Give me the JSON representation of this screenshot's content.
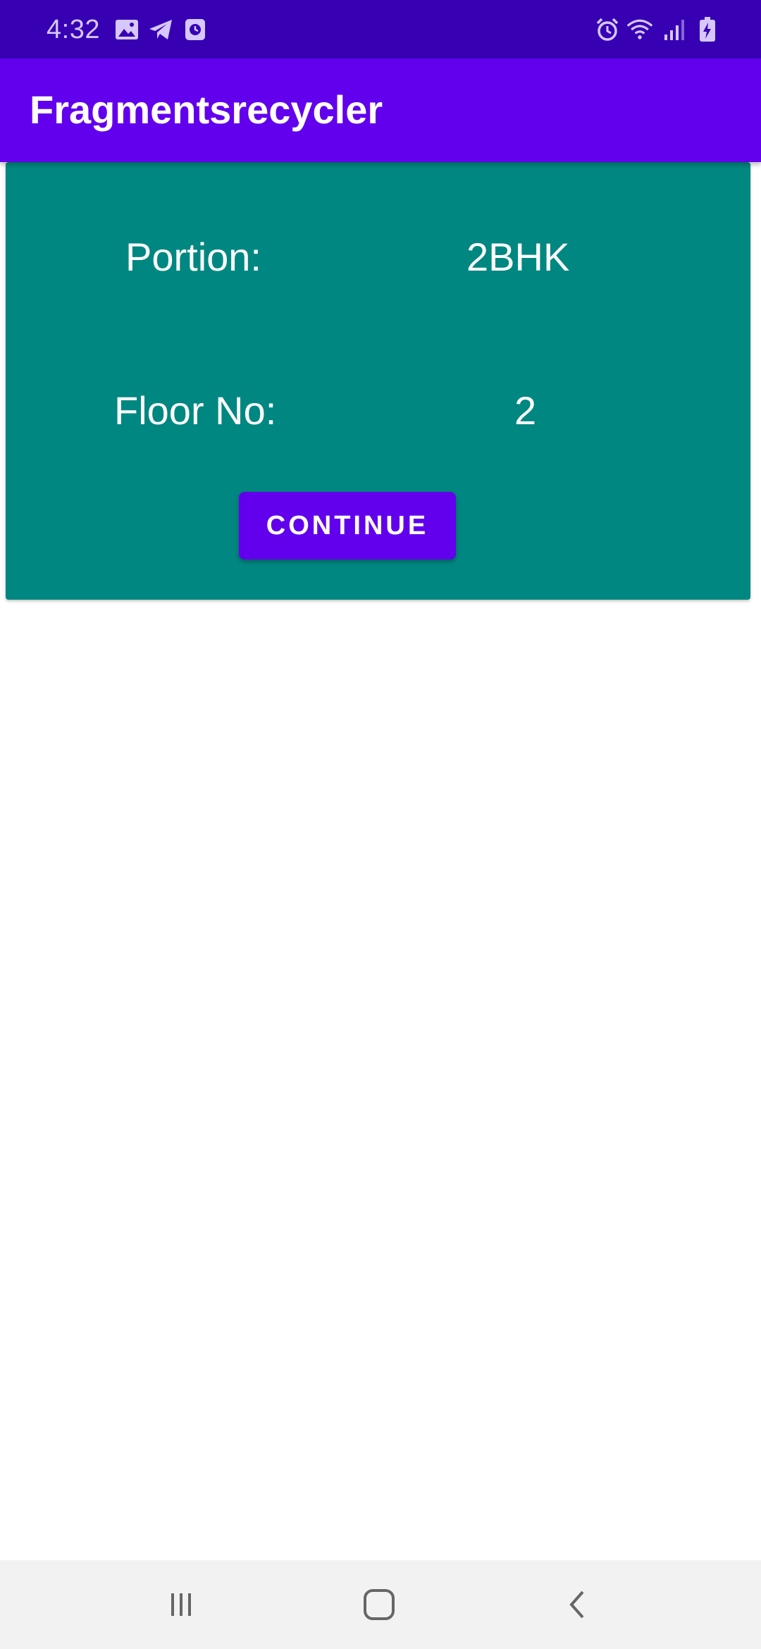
{
  "status_bar": {
    "time": "4:32",
    "icons_left": [
      "gallery-icon",
      "telegram-icon",
      "clock-app-icon"
    ],
    "icons_right": [
      "alarm-icon",
      "wifi-icon",
      "signal-icon",
      "battery-charging-icon"
    ]
  },
  "app_bar": {
    "title": "Fragmentsrecycler"
  },
  "card": {
    "background_color": "#008781",
    "rows": [
      {
        "label": "Portion:",
        "value": "2BHK"
      },
      {
        "label": "Floor No:",
        "value": "2"
      }
    ],
    "button_label": "CONTINUE"
  },
  "nav_bar": {
    "buttons": [
      "recent-apps-icon",
      "home-icon",
      "back-icon"
    ]
  },
  "colors": {
    "status_bar": "#3700b3",
    "primary": "#6200ee",
    "card": "#008781"
  }
}
